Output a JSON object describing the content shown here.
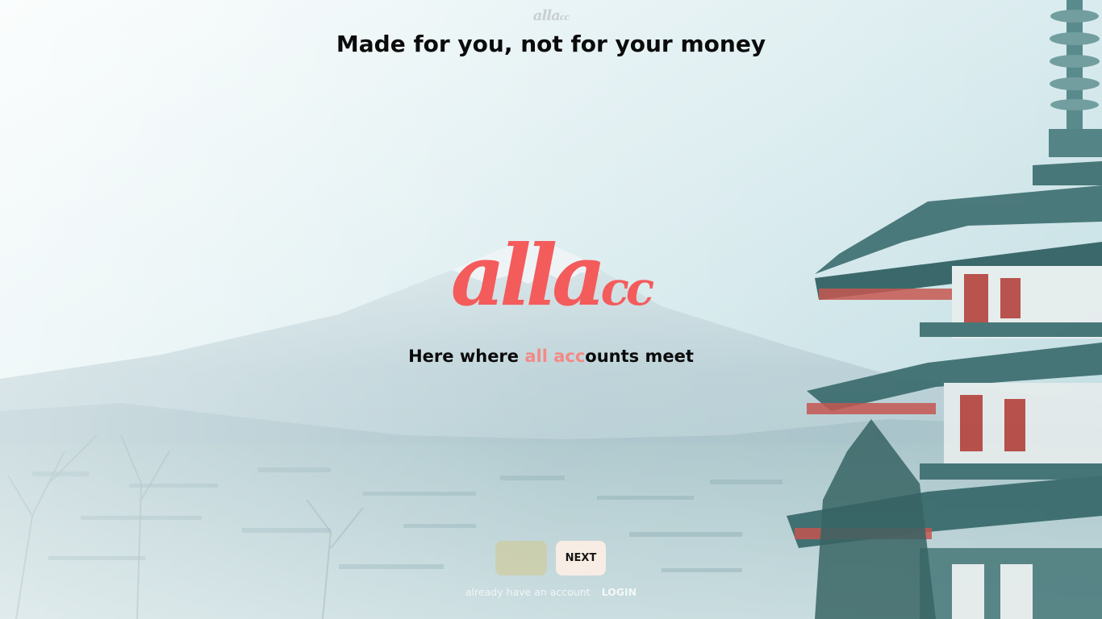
{
  "header": {
    "logo_big": "alla",
    "logo_small": "cc",
    "headline": "Made for you, not for your money"
  },
  "brand": {
    "logo_big": "alla",
    "logo_small": "cc",
    "color": "#f45b5b"
  },
  "tagline": {
    "before": "Here where ",
    "accent": "all acc",
    "after": "ounts meet",
    "accent_color": "#f28a86"
  },
  "controls": {
    "next_label": "NEXT"
  },
  "footer": {
    "hint": "already have an account",
    "login_label": "LOGIN"
  }
}
